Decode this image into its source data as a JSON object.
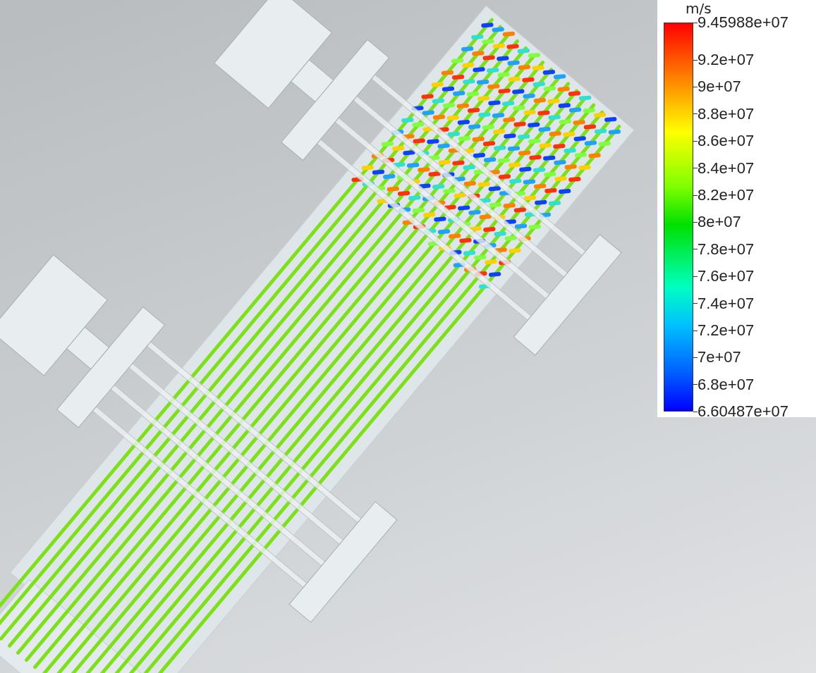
{
  "legend": {
    "unit": "m/s",
    "ticks": [
      "9.45988e+07",
      "9.2e+07",
      "9e+07",
      "8.8e+07",
      "8.6e+07",
      "8.4e+07",
      "8.2e+07",
      "8e+07",
      "7.8e+07",
      "7.6e+07",
      "7.4e+07",
      "7.2e+07",
      "7e+07",
      "6.8e+07",
      "6.60487e+07"
    ]
  }
}
